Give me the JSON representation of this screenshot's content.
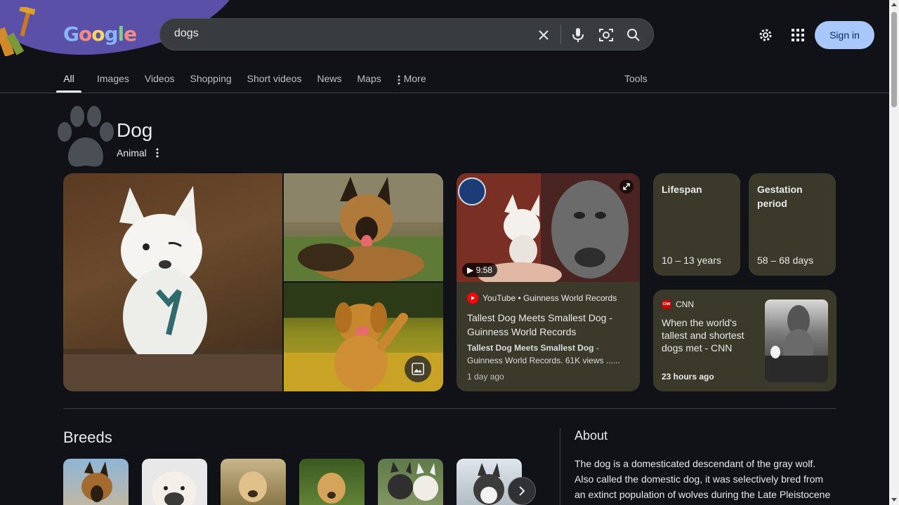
{
  "search": {
    "query": "dogs"
  },
  "header": {
    "signin_label": "Sign in",
    "logo_text": "Google"
  },
  "tabs": [
    {
      "label": "All",
      "active": true
    },
    {
      "label": "Images"
    },
    {
      "label": "Videos"
    },
    {
      "label": "Shopping"
    },
    {
      "label": "Short videos"
    },
    {
      "label": "News"
    },
    {
      "label": "Maps"
    },
    {
      "label": "More"
    }
  ],
  "tools_label": "Tools",
  "entity": {
    "title": "Dog",
    "subtitle": "Animal"
  },
  "video": {
    "duration": "9:58",
    "source": "YouTube • Guinness World Records",
    "title": "Tallest Dog Meets Smallest Dog - Guinness World Records",
    "snippet_bold": "Tallest Dog Meets Smallest Dog",
    "snippet_rest": " - Guinness World Records. 61K views ......",
    "time": "1 day ago"
  },
  "facts": [
    {
      "label": "Lifespan",
      "value": "10 – 13 years"
    },
    {
      "label": "Gestation period",
      "value": "58 – 68 days"
    }
  ],
  "news": {
    "source": "CNN",
    "logo": "CNN",
    "title": "When the world's tallest and shortest dogs met - CNN",
    "time": "23 hours ago"
  },
  "breeds": {
    "title": "Breeds"
  },
  "about": {
    "title": "About",
    "text": "The dog is a domesticated descendant of the gray wolf. Also called the domestic dog, it was selectively bred from an extinct population of wolves during the Late Pleistocene"
  },
  "colors": {
    "background": "#101218",
    "card": "#3b3a2a",
    "signin_bg": "#a8c7fa",
    "accent_text": "#e8eaed"
  },
  "icons": [
    "clear-icon",
    "mic-icon",
    "lens-icon",
    "search-icon",
    "settings-icon",
    "apps-icon",
    "more-vert-icon",
    "image-icon",
    "expand-icon",
    "play-icon",
    "chevron-right-icon",
    "paw-icon"
  ]
}
